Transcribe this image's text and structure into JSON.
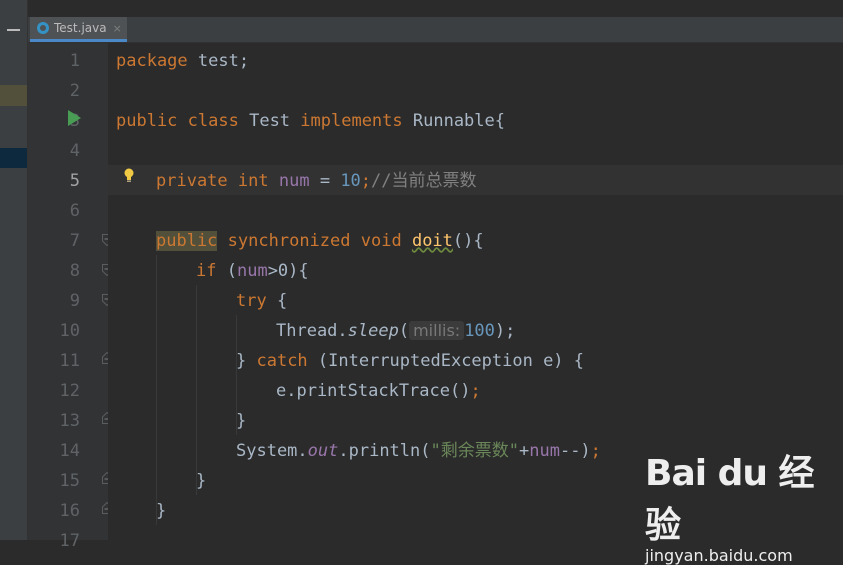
{
  "tab": {
    "filename": "Test.java",
    "close": "×"
  },
  "line_numbers": [
    "1",
    "2",
    "3",
    "4",
    "5",
    "6",
    "7",
    "8",
    "9",
    "10",
    "11",
    "12",
    "13",
    "14",
    "15",
    "16",
    "17"
  ],
  "code": {
    "l1_kw": "package",
    "l1_rest": " test;",
    "l3_kw1": "public",
    "l3_kw2": "class",
    "l3_name": " Test ",
    "l3_kw3": "implements",
    "l3_rest": " Runnable{",
    "l5_kw1": "private",
    "l5_kw2": "int",
    "l5_field": "num",
    "l5_eq": " = ",
    "l5_num": "10",
    "l5_semi": ";",
    "l5_comment": "//当前总票数",
    "l7_kw1": "public",
    "l7_kw2": "synchronized",
    "l7_kw3": "void",
    "l7_fn": "doit",
    "l7_rest": "(){",
    "l8_kw": "if",
    "l8_open": " (",
    "l8_field": "num",
    "l8_rest": ">0){",
    "l9_kw": "try",
    "l9_rest": " {",
    "l10_cls": "Thread.",
    "l10_method": "sleep",
    "l10_open": "(",
    "l10_hint": "millis:",
    "l10_num": "100",
    "l10_close": ");",
    "l11_close": "} ",
    "l11_kw": "catch",
    "l11_rest": " (InterruptedException e) {",
    "l12_code": "e.printStackTrace()",
    "l12_semi": ";",
    "l13_code": "}",
    "l14_cls": "System.",
    "l14_field": "out",
    "l14_method": ".println(",
    "l14_str": "\"剩余票数\"",
    "l14_plus": "+",
    "l14_field2": "num",
    "l14_rest": "--)",
    "l14_semi": ";",
    "l15_code": "}",
    "l16_code": "}"
  },
  "watermark": {
    "logo": "Bai du 经验",
    "url": "jingyan.baidu.com"
  },
  "colors": {
    "keyword": "#cc7832",
    "number": "#6897bb",
    "string": "#6a8759",
    "field": "#9876aa",
    "comment": "#808080",
    "run": "#499c54"
  },
  "icons": {
    "run": "run-gutter-icon",
    "bulb": "intention-bulb-icon",
    "file": "java-class-icon"
  }
}
